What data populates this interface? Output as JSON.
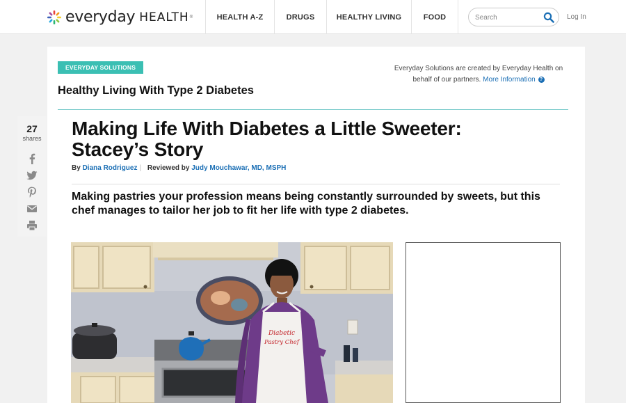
{
  "brand": {
    "everyday": "everyday",
    "health": "HEALTH",
    "tm": "®"
  },
  "nav": [
    {
      "label": "HEALTH A-Z"
    },
    {
      "label": "DRUGS"
    },
    {
      "label": "HEALTHY LIVING"
    },
    {
      "label": "FOOD"
    }
  ],
  "search": {
    "placeholder": "Search"
  },
  "login": "Log In",
  "badge": "EVERYDAY SOLUTIONS",
  "section_title": "Healthy Living With Type 2 Diabetes",
  "partner_note": {
    "line1": "Everyday Solutions are created by Everyday Health on",
    "line2": "behalf of our partners.",
    "link": "More Information",
    "help": "?"
  },
  "share": {
    "count": "27",
    "label": "shares"
  },
  "article": {
    "headline_line1": "Making Life With Diabetes a Little Sweeter:",
    "headline_line2": "Stacey’s Story",
    "by_label": "By",
    "author": "Diana Rodriguez",
    "separator": "|",
    "reviewed_label": "Reviewed by",
    "reviewer": "Judy Mouchawar, MD, MSPH",
    "dek": "Making pastries your profession means being constantly surrounded by sweets, but this chef manages to tailor her job to fit her life with type 2 diabetes."
  },
  "hero": {
    "apron_line1": "Diabetic",
    "apron_line2": "Pastry Chef"
  },
  "colors": {
    "teal": "#3bbfb3",
    "link": "#1b6fb5",
    "rule": "#6fc7c7"
  }
}
